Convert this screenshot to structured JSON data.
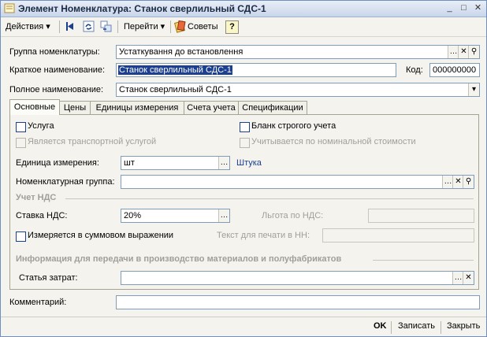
{
  "window": {
    "title": "Элемент Номенклатура: Станок сверлильный СДС-1",
    "buttons": {
      "minimize": "_",
      "maximize": "□",
      "close": "✕"
    }
  },
  "toolbar": {
    "actions_label": "Действия",
    "goto_label": "Перейти",
    "tips_label": "Советы",
    "help_label": "?"
  },
  "header": {
    "group_label": "Группа номенклатуры:",
    "group_value": "Устаткування до встановлення",
    "short_name_label": "Краткое наименование:",
    "short_name_value": "Станок сверлильный СДС-1",
    "code_label": "Код:",
    "code_value": "000000000",
    "full_name_label": "Полное наименование:",
    "full_name_value": "Станок сверлильный СДС-1"
  },
  "tabs": [
    {
      "label": "Основные"
    },
    {
      "label": "Цены"
    },
    {
      "label": "Единицы измерения"
    },
    {
      "label": "Счета учета"
    },
    {
      "label": "Спецификации"
    }
  ],
  "main": {
    "service_label": "Услуга",
    "transport_label": "Является транспортной услугой",
    "strict_form_label": "Бланк строгого учета",
    "nominal_label": "Учитывается по номинальной стоимости",
    "unit_label": "Единица измерения:",
    "unit_value": "шт",
    "unit_link": "Штука",
    "nom_group_label": "Номенклатурная группа:",
    "nom_group_value": "",
    "vat_section": "Учет НДС",
    "vat_rate_label": "Ставка НДС:",
    "vat_rate_value": "20%",
    "vat_benefit_label": "Льгота по НДС:",
    "vat_benefit_value": "",
    "sum_expr_label": "Измеряется в суммовом выражении",
    "print_text_label": "Текст для печати в НН:",
    "print_text_value": "",
    "prod_section": "Информация для передачи в производство материалов и полуфабрикатов",
    "cost_item_label": "Статья затрат:",
    "cost_item_value": ""
  },
  "comment": {
    "label": "Комментарий:",
    "value": ""
  },
  "footer": {
    "ok": "OK",
    "write": "Записать",
    "close": "Закрыть"
  }
}
